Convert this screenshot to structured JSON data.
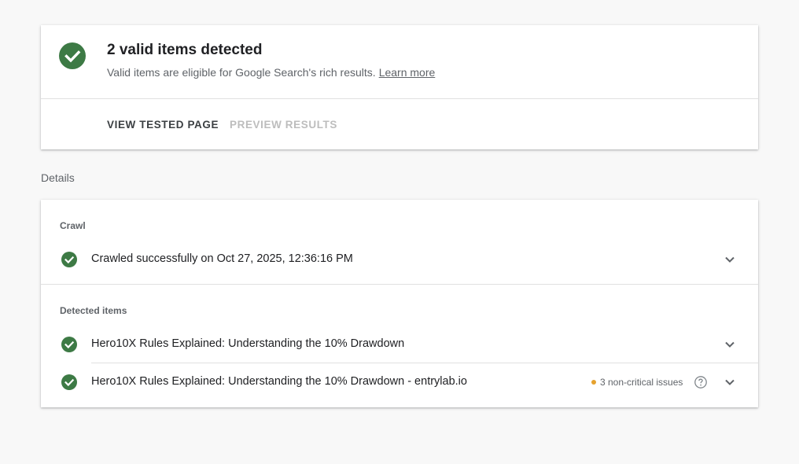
{
  "summary": {
    "title": "2 valid items detected",
    "subtitle": "Valid items are eligible for Google Search's rich results.",
    "learn_more": "Learn more",
    "actions": {
      "view_tested_page": "VIEW TESTED PAGE",
      "preview_results": "PREVIEW RESULTS"
    },
    "status_icon": "check-circle-icon"
  },
  "details": {
    "label": "Details",
    "crawl": {
      "section_label": "Crawl",
      "status_text": "Crawled successfully on Oct 27, 2025, 12:36:16 PM",
      "status_icon": "check-circle-icon",
      "expand_icon": "chevron-down-icon"
    },
    "detected_items": {
      "section_label": "Detected items",
      "items": [
        {
          "title": "Hero10X Rules Explained: Understanding the 10% Drawdown",
          "status_icon": "check-circle-icon",
          "issues": ""
        },
        {
          "title": "Hero10X Rules Explained: Understanding the 10% Drawdown - entrylab.io",
          "status_icon": "check-circle-icon",
          "issues": "3 non-critical issues"
        }
      ]
    }
  },
  "colors": {
    "success": "#3d7a45",
    "warning": "#e6a22e",
    "background": "#f8f8f8"
  }
}
